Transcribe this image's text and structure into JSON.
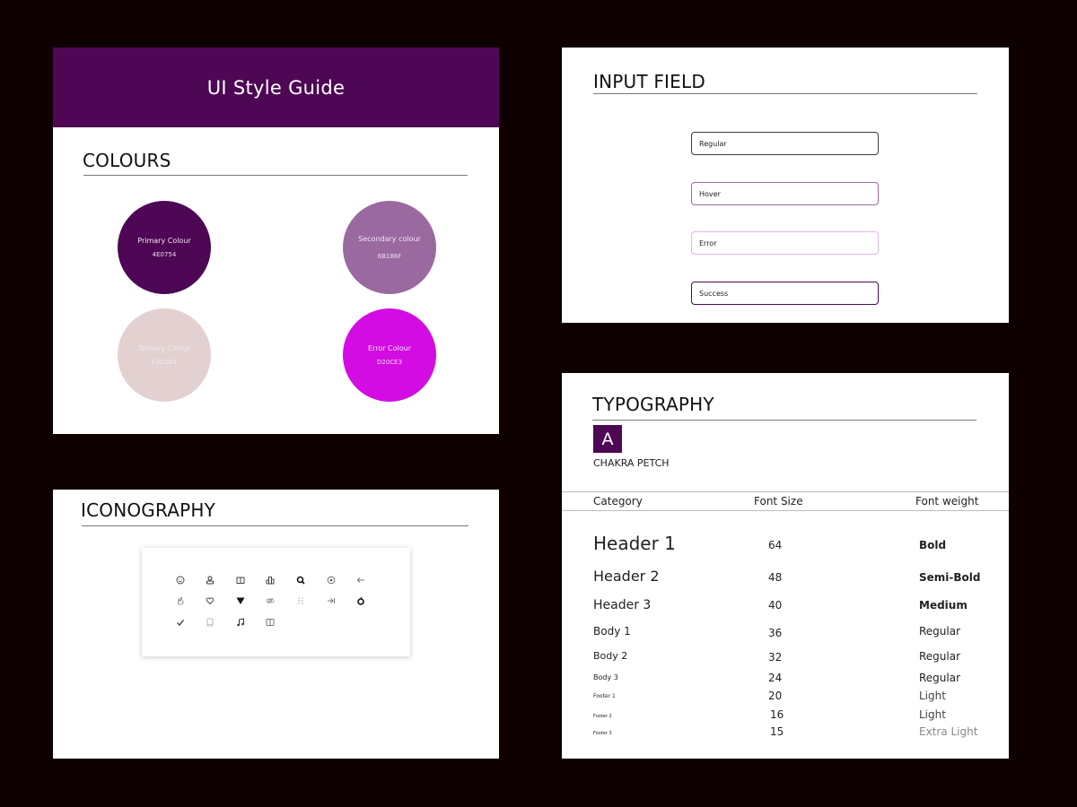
{
  "colours_panel": {
    "banner_title": "UI Style Guide",
    "section_title": "COLOURS",
    "swatches": [
      {
        "name": "Primary Colour",
        "hex": "4E0754",
        "color": "#4E0754"
      },
      {
        "name": "Secondary colour",
        "hex": "6B186F",
        "color": "#9A69A0"
      },
      {
        "name": "Tertiary Colour",
        "hex": "E3D1D1",
        "color": "#E3D1D1"
      },
      {
        "name": "Error Colour",
        "hex": "D20CE3",
        "color": "#D20CE3"
      }
    ]
  },
  "iconography_panel": {
    "section_title": "ICONOGRAPHY",
    "icons": [
      "smiley-icon",
      "user-icon",
      "book-open-icon",
      "buildings-icon",
      "search-icon",
      "radio-target-icon",
      "arrow-left-icon",
      "fire-icon",
      "heart-icon",
      "triangle-down-icon",
      "link-icon",
      "grid-dots-icon",
      "arrow-right-to-line-icon",
      "apple-icon",
      "check-icon",
      "tablet-icon",
      "music-note-icon",
      "book-icon"
    ]
  },
  "input_panel": {
    "section_title": "INPUT FIELD",
    "fields": [
      {
        "label": "Regular",
        "state": "regular",
        "border": "#3a3a3a"
      },
      {
        "label": "Hover",
        "state": "hover",
        "border": "#9A69A0"
      },
      {
        "label": "Error",
        "state": "error",
        "border": "#e0b8e4"
      },
      {
        "label": "Success",
        "state": "success",
        "border": "#4E0754"
      }
    ]
  },
  "typography_panel": {
    "section_title": "TYPOGRAPHY",
    "badge_letter": "A",
    "font_name": "CHAKRA PETCH",
    "headers": [
      "Category",
      "Font Size",
      "Font weight"
    ],
    "rows": [
      {
        "category": "Header 1",
        "size": "64",
        "weight": "Bold"
      },
      {
        "category": "Header 2",
        "size": "48",
        "weight": "Semi-Bold"
      },
      {
        "category": "Header 3",
        "size": "40",
        "weight": "Medium"
      },
      {
        "category": "Body 1",
        "size": "36",
        "weight": "Regular"
      },
      {
        "category": "Body 2",
        "size": "32",
        "weight": "Regular"
      },
      {
        "category": "Body 3",
        "size": "24",
        "weight": "Regular"
      },
      {
        "category": "Footer 1",
        "size": "20",
        "weight": "Light"
      },
      {
        "category": "Footer 2",
        "size": "16",
        "weight": "Light"
      },
      {
        "category": "Footer 3",
        "size": "15",
        "weight": "Extra Light"
      }
    ]
  }
}
